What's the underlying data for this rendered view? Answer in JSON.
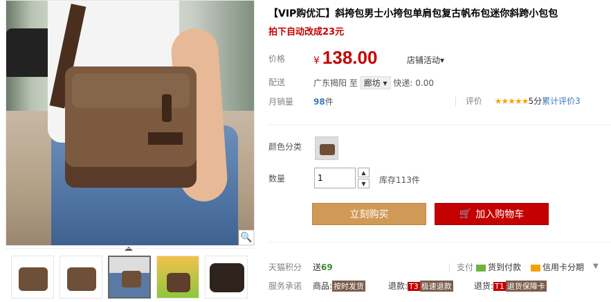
{
  "product": {
    "title": "【VIP购优汇】斜挎包男士小挎包单肩包复古帆布包迷你斜跨小包包",
    "subtitle": "拍下自动改成23元"
  },
  "price": {
    "label": "价格",
    "currency": "¥",
    "value": "138.00",
    "promo": "店铺活动"
  },
  "shipping": {
    "label": "配送",
    "from": "广东揭阳",
    "to_word": "至",
    "city": "廊坊",
    "express": "快递: 0.00"
  },
  "sales": {
    "label": "月销量",
    "count": "98",
    "unit": "件",
    "rating_label": "评价",
    "stars": "★★★★★",
    "score": "5分",
    "reviews": "累计评价3"
  },
  "options": {
    "color_label": "颜色分类",
    "qty_label": "数量",
    "qty_value": "1",
    "stock": "库存113件"
  },
  "actions": {
    "buy_now": "立刻购买",
    "add_cart": "加入购物车"
  },
  "points": {
    "label": "天猫积分",
    "prefix": "送",
    "value": "69"
  },
  "payment": {
    "label": "支付",
    "cod": "货到付款",
    "credit": "信用卡分期"
  },
  "service": {
    "label": "服务承诺",
    "goods_prefix": "商品:",
    "goods_tag": "按时发货",
    "refund_prefix": "退款:",
    "refund_code": "T3",
    "refund_tag": "极速退款",
    "return_prefix": "退货:",
    "return_code": "T1",
    "return_tag": "退货保障卡"
  },
  "icons": {
    "zoom": "🔍",
    "cart": "🛒",
    "chevron": "▾",
    "up": "▲",
    "down": "▼"
  },
  "colors": {
    "accent": "#c40000",
    "buy": "#d09a56"
  }
}
